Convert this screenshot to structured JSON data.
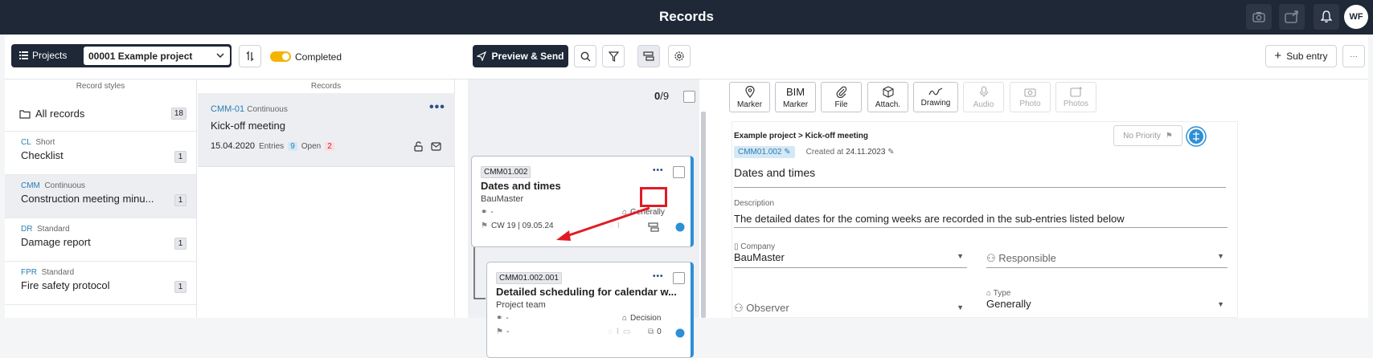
{
  "topbar": {
    "title": "Records",
    "avatar": "WF",
    "icons": [
      "camera-icon",
      "upload-icon",
      "bell-icon"
    ]
  },
  "toolbar": {
    "projects_label": "Projects",
    "project_value": "00001 Example project",
    "completed_label": "Completed",
    "completed_on": true,
    "preview_label": "Preview & Send",
    "sub_entry_label": "Sub entry",
    "more": "···"
  },
  "styles": {
    "header": "Record styles",
    "all": {
      "label": "All records",
      "count": "18"
    },
    "items": [
      {
        "code": "CL",
        "type": "Short",
        "name": "Checklist",
        "count": "1"
      },
      {
        "code": "CMM",
        "type": "Continuous",
        "name": "Construction meeting minu...",
        "count": "1"
      },
      {
        "code": "DR",
        "type": "Standard",
        "name": "Damage report",
        "count": "1"
      },
      {
        "code": "FPR",
        "type": "Standard",
        "name": "Fire safety protocol",
        "count": "1"
      }
    ]
  },
  "records": {
    "header": "Records",
    "items": [
      {
        "code": "CMM-01",
        "type": "Continuous",
        "name": "Kick-off meeting",
        "date": "15.04.2020",
        "entries_label": "Entries",
        "entries": "9",
        "open_label": "Open",
        "open": "2"
      }
    ]
  },
  "entries": {
    "counter_done": "0",
    "counter_total": "/9",
    "items": [
      {
        "code": "CMM01.002",
        "title": "Dates and times",
        "author": "BauMaster",
        "dash": "-",
        "tag": "Generally",
        "date": "CW 19 | 09.05.24"
      },
      {
        "code": "CMM01.002.001",
        "title": "Detailed scheduling for calendar w...",
        "author": "Project team",
        "dash": "-",
        "tag": "Decision",
        "flag": "-",
        "sub_count": "0"
      }
    ]
  },
  "detail": {
    "tools": [
      {
        "label": "Marker",
        "top": "",
        "icon": "pin-icon"
      },
      {
        "label": "Marker",
        "top": "BIM",
        "icon": ""
      },
      {
        "label": "File",
        "top": "",
        "icon": "paperclip-icon"
      },
      {
        "label": "Attach.",
        "top": "",
        "icon": "cube-icon"
      },
      {
        "label": "Drawing",
        "top": "",
        "icon": "pen-icon"
      },
      {
        "label": "Audio",
        "top": "",
        "icon": "mic-icon"
      },
      {
        "label": "Photo",
        "top": "",
        "icon": "camera-icon"
      },
      {
        "label": "Photos",
        "top": "",
        "icon": "photos-icon"
      }
    ],
    "breadcrumb": "Example project > Kick-off meeting",
    "code": "CMM01.002",
    "created_label": "Created at",
    "created_date": "24.11.2023",
    "priority": "No Priority",
    "title": "Dates and times",
    "description_label": "Description",
    "description": "The detailed dates for the coming weeks are recorded in the sub-entries listed below",
    "company_label": "Company",
    "company": "BauMaster",
    "responsible_placeholder": "Responsible",
    "observer_placeholder": "Observer",
    "type_label": "Type",
    "type": "Generally"
  },
  "colors": {
    "topbar": "#1e2836",
    "accent": "#2d8fd5",
    "toggle": "#f4b400",
    "highlight": "#e01b24"
  }
}
